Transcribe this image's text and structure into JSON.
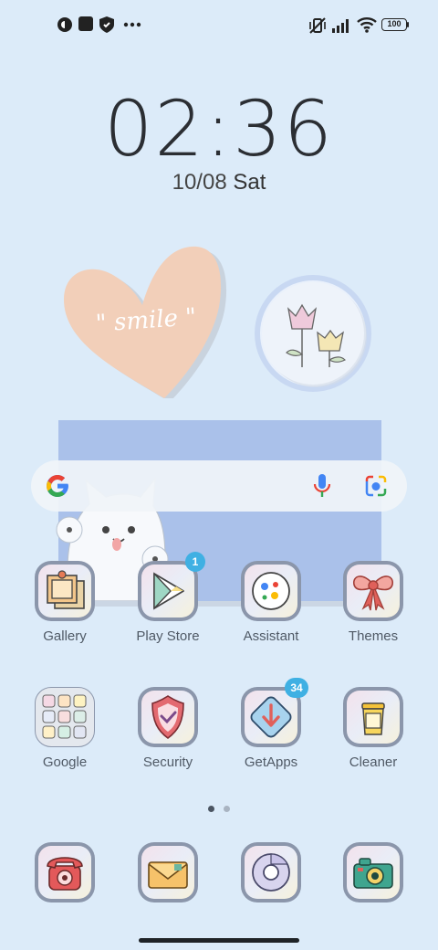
{
  "status_bar": {
    "icons_left": [
      "app-notification-icon",
      "square-notification-icon",
      "shield-notification-icon",
      "more-dots-icon"
    ],
    "icons_right": [
      "vibrate-off-icon",
      "signal-icon",
      "wifi-icon"
    ],
    "battery": "100"
  },
  "clock": {
    "time": "02:36",
    "date": "10/08",
    "day": "Sat"
  },
  "widgets": {
    "heart_text": "\" smile \""
  },
  "search": {
    "g_icon": "google-g-icon",
    "mic_icon": "microphone-icon",
    "lens_icon": "camera-lens-icon"
  },
  "apps": [
    {
      "label": "Gallery",
      "icon": "photos-icon"
    },
    {
      "label": "Play Store",
      "icon": "play-store-icon",
      "badge": "1"
    },
    {
      "label": "Assistant",
      "icon": "assistant-icon"
    },
    {
      "label": "Themes",
      "icon": "bow-icon"
    },
    {
      "label": "Google",
      "icon": "folder-icon"
    },
    {
      "label": "Security",
      "icon": "shield-check-icon"
    },
    {
      "label": "GetApps",
      "icon": "download-icon",
      "badge": "34"
    },
    {
      "label": "Cleaner",
      "icon": "trash-icon"
    }
  ],
  "dock": [
    {
      "icon": "phone-icon"
    },
    {
      "icon": "messages-icon"
    },
    {
      "icon": "chrome-icon"
    },
    {
      "icon": "camera-icon"
    }
  ],
  "page_indicator": {
    "count": 2,
    "active": 1
  }
}
